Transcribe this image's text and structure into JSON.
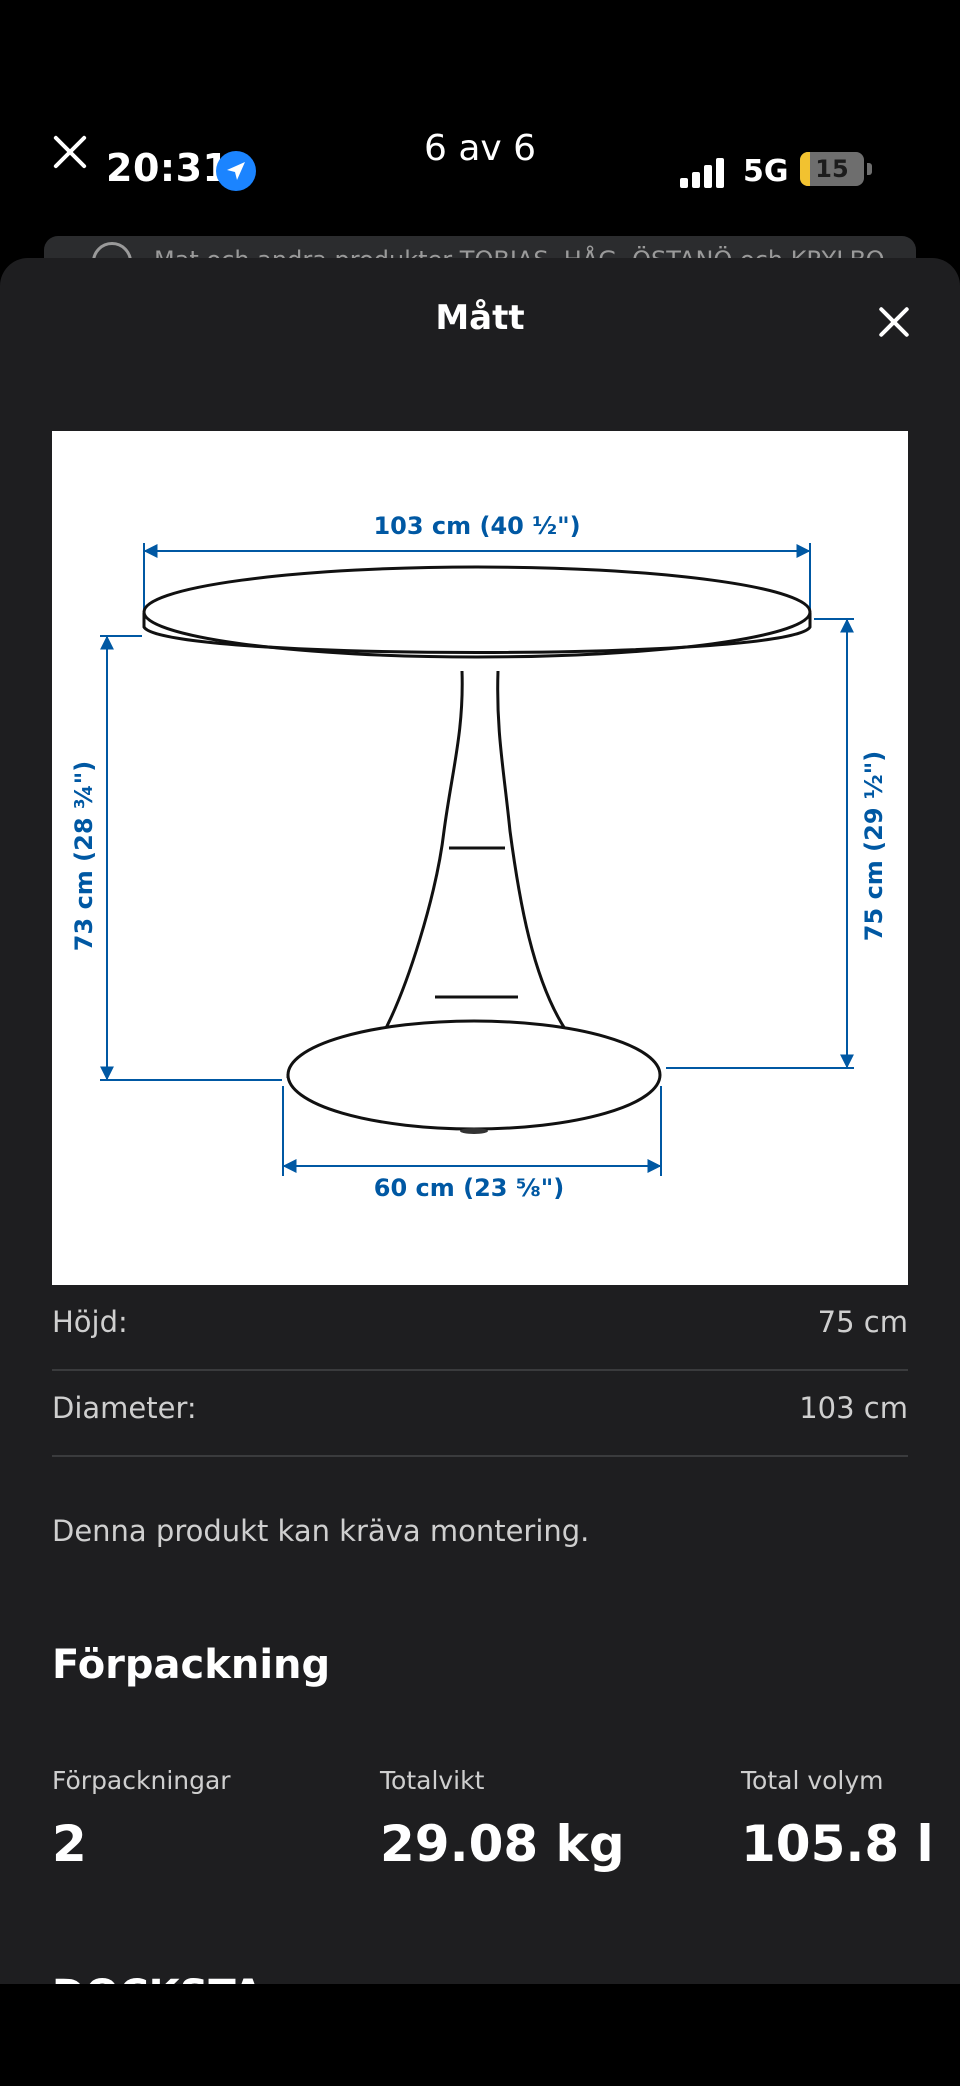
{
  "status_bar": {
    "time": "20:31",
    "page_indicator": "6 av 6",
    "network": "5G",
    "battery": "15",
    "battery_level": 0.15
  },
  "peek": {
    "text": "Mat och andra produkter    TOBIAS, HÅG, ÖSTANÖ och KRYLBO"
  },
  "sheet": {
    "title": "Mått"
  },
  "diagram": {
    "width_label": "103 cm (40 ½\")",
    "left_height_label": "73 cm (28 ¾\")",
    "right_height_label": "75 cm (29 ½\")",
    "base_label": "60 cm (23 ⅝\")",
    "dimension_color": "#0058a3"
  },
  "specs": [
    {
      "label": "Höjd:",
      "value": "75 cm"
    },
    {
      "label": "Diameter:",
      "value": "103 cm"
    }
  ],
  "assembly_note": "Denna produkt kan kräva montering.",
  "packaging": {
    "heading": "Förpackning",
    "columns": [
      {
        "label": "Förpackningar",
        "value": "2"
      },
      {
        "label": "Totalvikt",
        "value": "29.08 kg"
      },
      {
        "label": "Total volym",
        "value": "105.8 l"
      }
    ],
    "next_heading": "DOCKSTA"
  }
}
